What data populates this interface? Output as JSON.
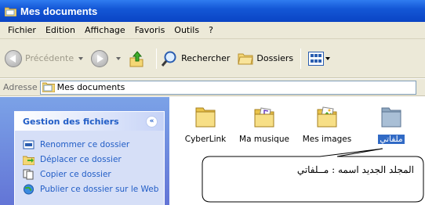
{
  "window": {
    "title": "Mes documents"
  },
  "menu": {
    "items": [
      "Fichier",
      "Edition",
      "Affichage",
      "Favoris",
      "Outils",
      "?"
    ]
  },
  "toolbar": {
    "back_label": "Précédente",
    "search_label": "Rechercher",
    "folders_label": "Dossiers"
  },
  "address": {
    "label": "Adresse",
    "value": "Mes documents"
  },
  "taskpane": {
    "title": "Gestion des fichiers",
    "collapse_glyph": "«",
    "items": [
      {
        "label": "Renommer ce dossier",
        "icon": "rename-icon"
      },
      {
        "label": "Déplacer ce dossier",
        "icon": "move-icon"
      },
      {
        "label": "Copier ce dossier",
        "icon": "copy-icon"
      },
      {
        "label": "Publier ce dossier sur le Web",
        "icon": "web-publish-icon"
      }
    ]
  },
  "files": [
    {
      "name": "CyberLink",
      "icon": "folder-icon",
      "selected": false
    },
    {
      "name": "Ma musique",
      "icon": "music-folder-icon",
      "selected": false
    },
    {
      "name": "Mes images",
      "icon": "pictures-folder-icon",
      "selected": false
    },
    {
      "name": "ملفاتي",
      "icon": "folder-icon",
      "selected": true
    }
  ],
  "callout": {
    "text": "المجلد الجديد اسمه : مــلفاتي"
  },
  "colors": {
    "titlebar": "#0a44c4",
    "chrome": "#ece9d8",
    "taskpane": "#7ba2e7",
    "task_link": "#215dc6",
    "selection": "#316ac5"
  }
}
